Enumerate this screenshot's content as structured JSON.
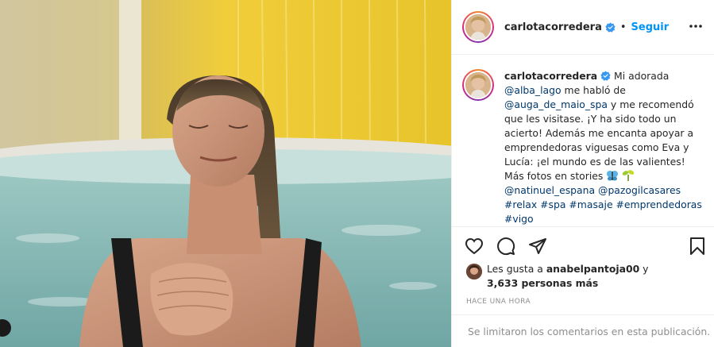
{
  "header": {
    "username": "carlotacorredera",
    "separator": "•",
    "follow_label": "Seguir"
  },
  "caption": {
    "username": "carlotacorredera",
    "lines": [
      {
        "parts": [
          {
            "t": "Mi adorada",
            "k": "text"
          }
        ]
      }
    ],
    "segments": {
      "s1": "Mi adorada",
      "m1": "@alba_lago",
      "s2": "me habló de",
      "m2": "@auga_de_maio_spa",
      "s3": "y me recomendó que les visitase. ¡Y ha sido todo un acierto! Además me encanta apoyar a emprendedoras viguesas como Eva y Lucía: ¡el mundo es de las valientes! Más fotos en stories",
      "m3": "@natinuel_espana",
      "m4": "@pazogilcasares",
      "t1": "#relax",
      "t2": "#spa",
      "t3": "#masaje",
      "t4": "#emprendedoras",
      "t5": "#vigo"
    }
  },
  "likes": {
    "prefix": "Les gusta a",
    "user": "anabelpantoja00",
    "conj": "y",
    "count_text": "3,633 personas más"
  },
  "timestamp": "HACE UNA HORA",
  "comments_disabled": "Se limitaron los comentarios en esta publicación.",
  "icons": {
    "verified": "verified-badge-icon",
    "more": "more-options-icon",
    "like": "heart-icon",
    "comment": "comment-icon",
    "share": "paper-plane-icon",
    "save": "bookmark-icon"
  },
  "colors": {
    "accent": "#0095f6",
    "mention": "#00376b",
    "muted": "#8e8e8e"
  }
}
